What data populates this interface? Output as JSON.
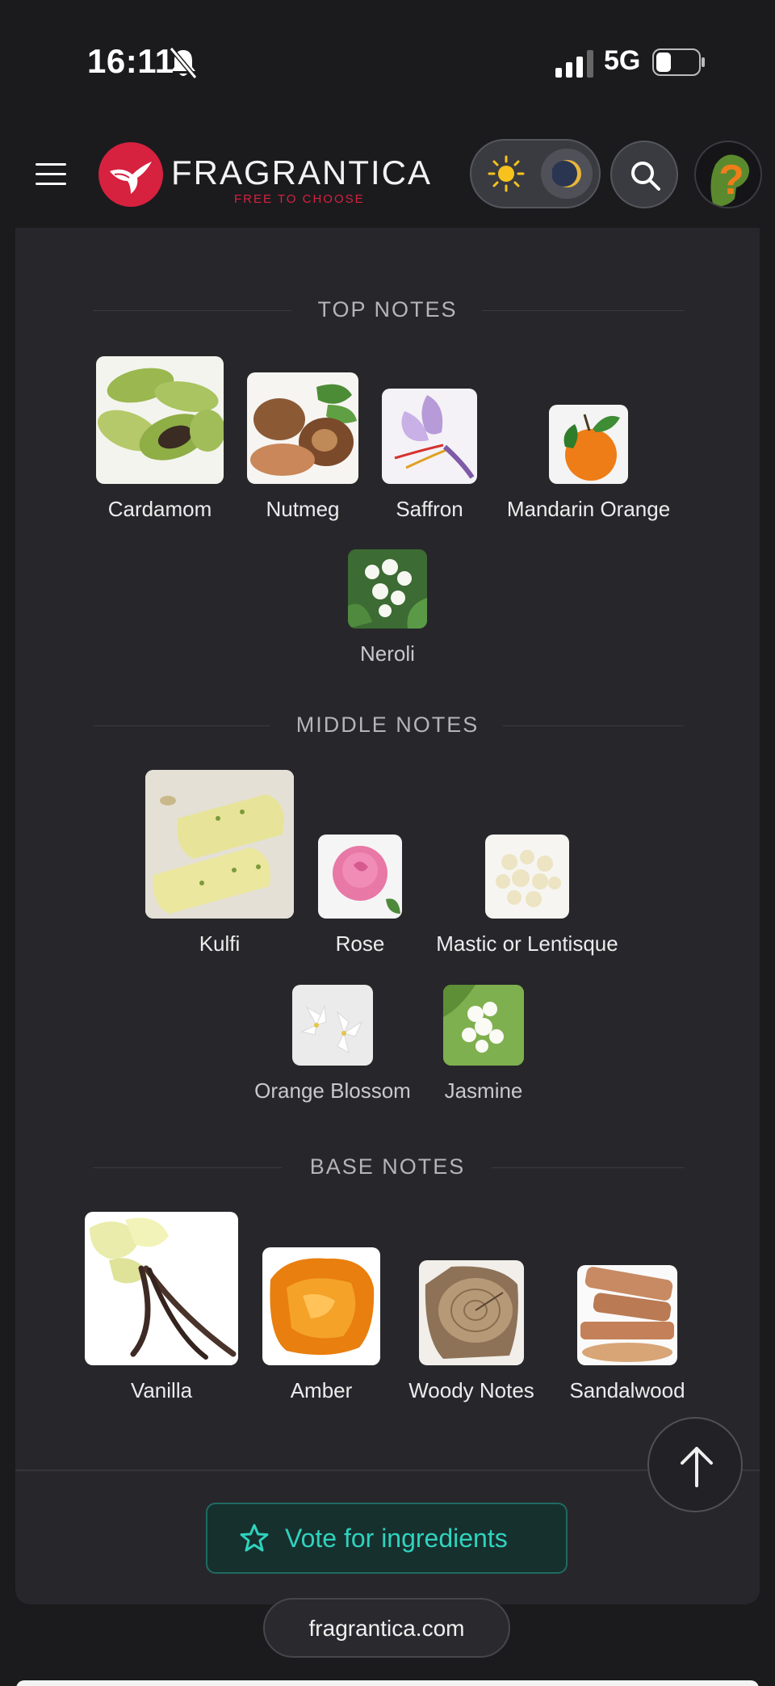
{
  "status": {
    "time": "16:11",
    "network": "5G"
  },
  "header": {
    "logo_name": "FRAGRANTICA",
    "logo_tagline": "FREE TO CHOOSE",
    "brand_color": "#d6213f",
    "icons": [
      "menu-icon",
      "sun-icon",
      "moon-icon",
      "search-icon",
      "help-icon"
    ]
  },
  "sections": {
    "top": {
      "title": "TOP NOTES",
      "notes": [
        "Cardamom",
        "Nutmeg",
        "Saffron",
        "Mandarin Orange",
        "Neroli"
      ]
    },
    "middle": {
      "title": "MIDDLE NOTES",
      "notes": [
        "Kulfi",
        "Rose",
        "Mastic or Lentisque",
        "Orange Blossom",
        "Jasmine"
      ]
    },
    "base": {
      "title": "BASE NOTES",
      "notes": [
        "Vanilla",
        "Amber",
        "Woody Notes",
        "Sandalwood"
      ]
    }
  },
  "vote": {
    "label": "Vote for ingredients",
    "accent": "#2fd3bd"
  },
  "url": "fragrantica.com"
}
